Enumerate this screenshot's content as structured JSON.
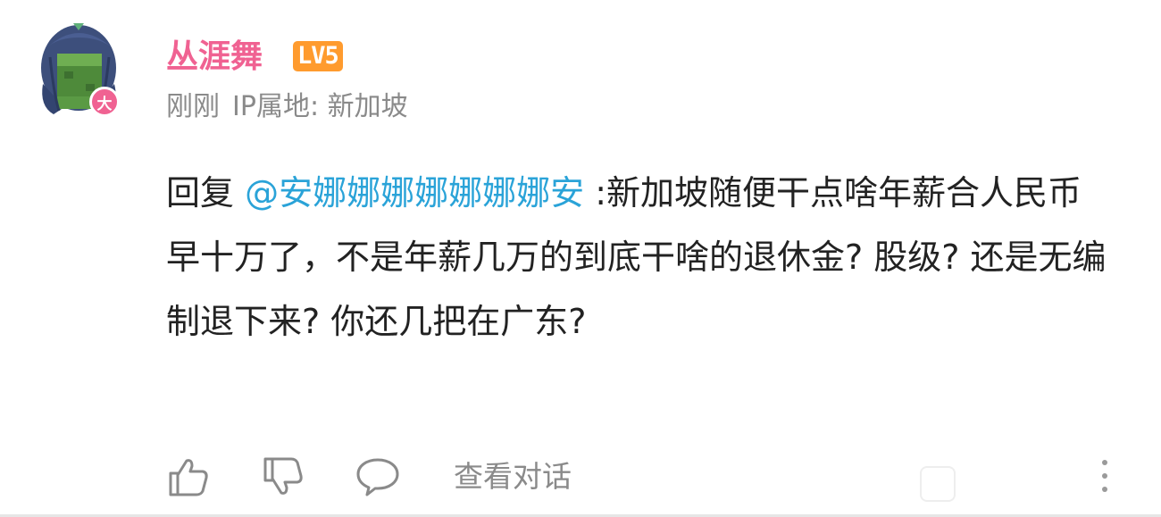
{
  "comment": {
    "user": {
      "name": "丛涯舞",
      "level": "LV5",
      "avatar_badge": "大"
    },
    "meta": {
      "time": "刚刚",
      "ip_location": "IP属地: 新加坡"
    },
    "content": {
      "reply_prefix": "回复",
      "mention": "@安娜娜娜娜娜娜娜安",
      "text": ":新加坡随便干点啥年薪合人民币早十万了，不是年薪几万的到底干啥的退休金? 股级? 还是无编制退下来? 你还几把在广东?"
    },
    "actions": {
      "like_icon": "thumbs-up-icon",
      "dislike_icon": "thumbs-down-icon",
      "reply_icon": "speech-bubble-icon",
      "view_conversation": "查看对话",
      "more_icon": "vertical-dots-icon"
    },
    "colors": {
      "username": "#f06292",
      "level_badge": "#ff9b2e",
      "mention": "#2aa3d8",
      "meta": "#8a8a8a",
      "text": "#222222"
    }
  }
}
